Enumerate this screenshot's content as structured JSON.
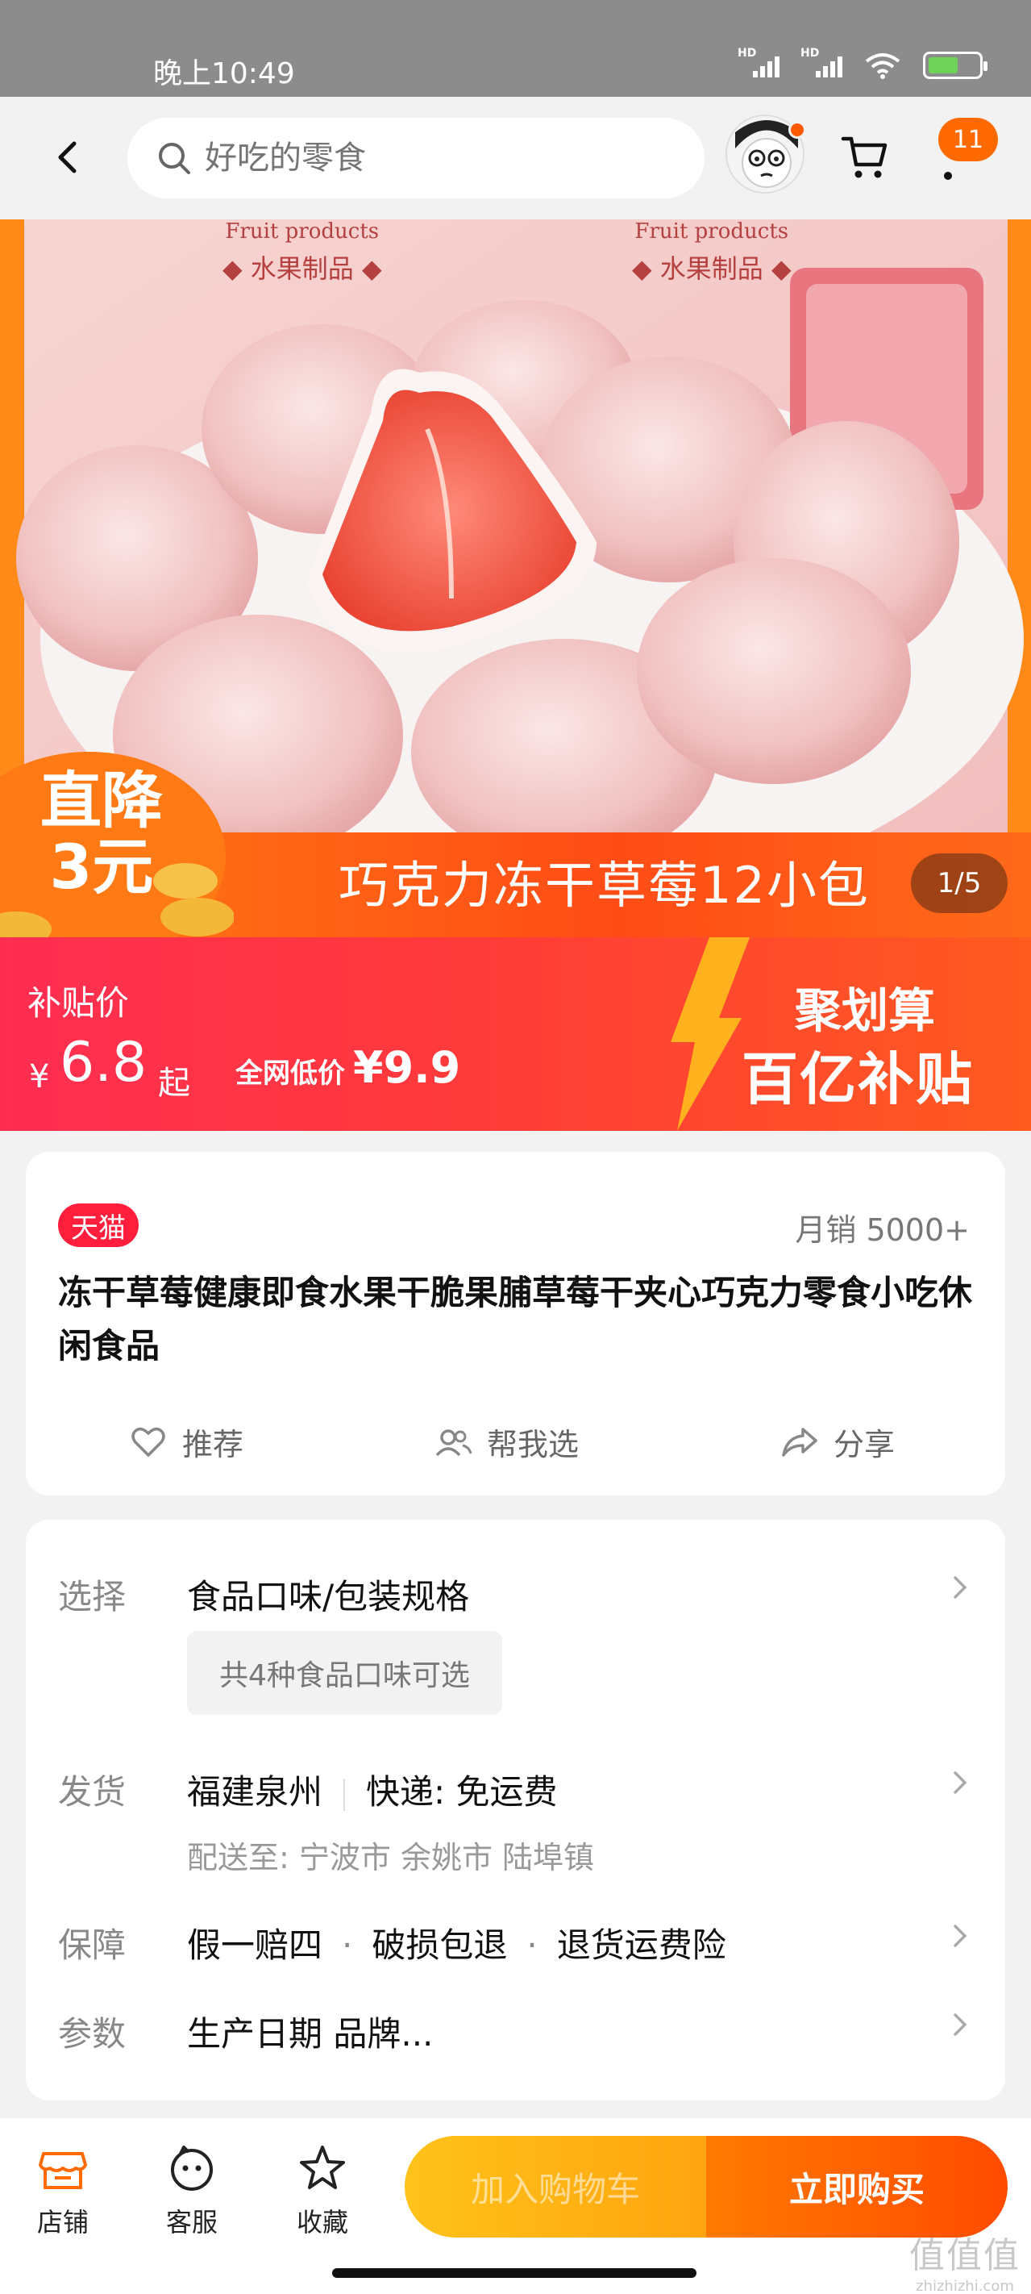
{
  "status_bar": {
    "time": "晚上10:49",
    "signal1_label": "HD",
    "signal2_label": "HD"
  },
  "nav": {
    "search_placeholder": "好吃的零食",
    "badge_count": "11"
  },
  "hero": {
    "label_en_1": "Fruit products",
    "label_cn_1": "◆ 水果制品 ◆",
    "label_en_2": "Fruit products",
    "label_cn_2": "◆ 水果制品 ◆",
    "drop_line1": "直降",
    "drop_line2": "3元",
    "caption": "巧克力冻干草莓12小包",
    "image_counter": "1/5"
  },
  "subsidy": {
    "label": "补贴价",
    "currency": "¥",
    "price": "6.8",
    "suffix": "起",
    "lowest_label": "全网低价",
    "lowest_price": "¥9.9",
    "promo_title": "聚划算",
    "promo_sub": "百亿补贴"
  },
  "product": {
    "platform_badge": "天猫",
    "monthly_sales": "月销 5000+",
    "title": "冻干草莓健康即食水果干脆果脯草莓干夹心巧克力零食小吃休闲食品",
    "actions": [
      {
        "label": "推荐",
        "icon": "heart-icon"
      },
      {
        "label": "帮我选",
        "icon": "people-icon"
      },
      {
        "label": "分享",
        "icon": "share-icon"
      }
    ]
  },
  "options": {
    "select_key": "选择",
    "select_val": "食品口味/包装规格",
    "select_chip": "共4种食品口味可选",
    "ship_key": "发货",
    "ship_origin": "福建泉州",
    "ship_method": "快递:  免运费",
    "ship_dest": "配送至: 宁波市 余姚市 陆埠镇",
    "guarantee_key": "保障",
    "guarantee_1": "假一赔四",
    "guarantee_2": "破损包退",
    "guarantee_3": "退货运费险",
    "params_key": "参数",
    "params_val": "生产日期 品牌..."
  },
  "bottom_bar": {
    "store": "店铺",
    "service": "客服",
    "favorite": "收藏",
    "add_to_cart": "加入购物车",
    "buy_now": "立即购买"
  },
  "watermark": {
    "big": "值值值",
    "small": "zhizhizhi.com"
  },
  "colors": {
    "accent": "#ff6a00",
    "tmall_red": "#ff1e3c",
    "subsidy_red": "#ff2d52",
    "cart_yellow": "#ffc21a"
  }
}
